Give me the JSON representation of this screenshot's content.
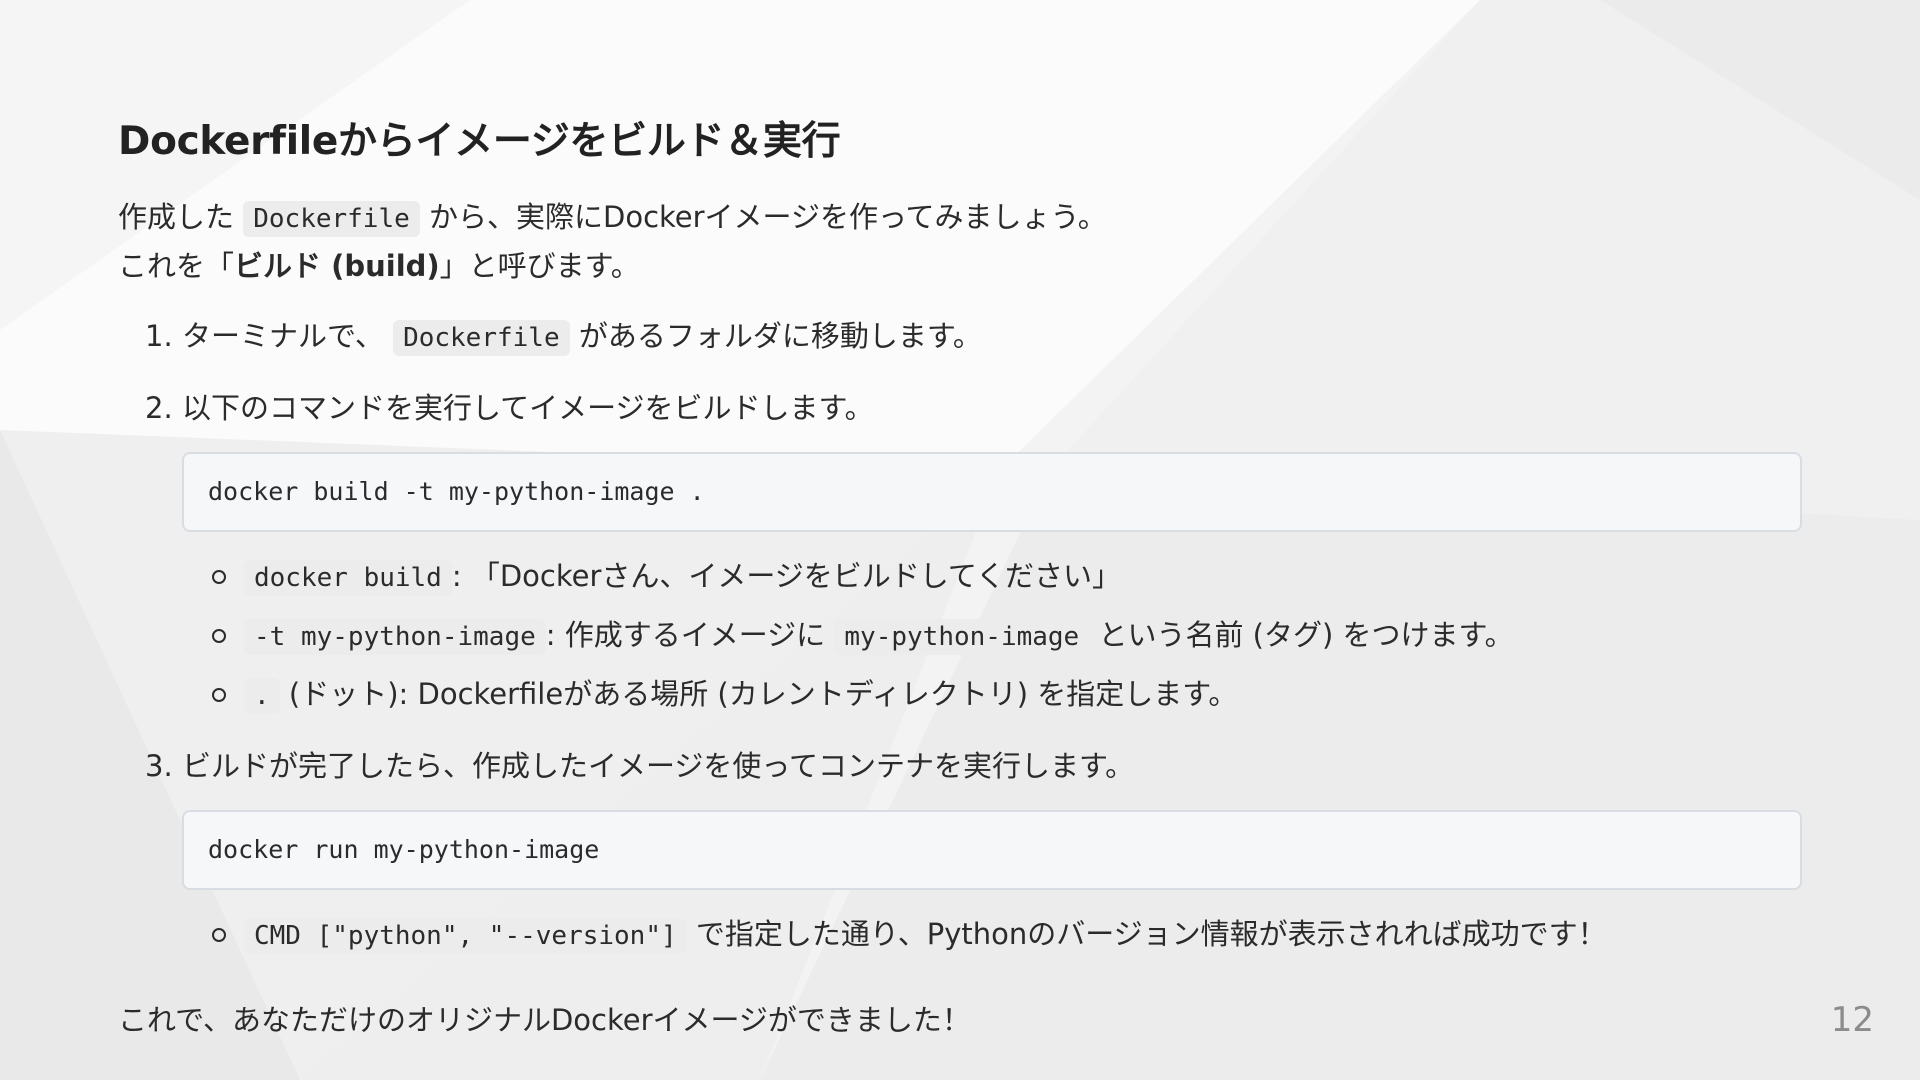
{
  "title": "Dockerfileからイメージをビルド＆実行",
  "intro": {
    "line1_before": "作成した",
    "line1_code": "Dockerfile",
    "line1_after": "から、実際にDockerイメージを作ってみましょう。",
    "line2_before": "これを「",
    "line2_bold": "ビルド (build)",
    "line2_after": "」と呼びます。"
  },
  "steps": [
    {
      "number": "1.",
      "text_before": "ターミナルで、",
      "code": "Dockerfile",
      "text_after": "があるフォルダに移動します。"
    },
    {
      "number": "2.",
      "text": "以下のコマンドを実行してイメージをビルドします。",
      "codeblock": "docker build -t my-python-image .",
      "bullets": [
        {
          "code": "docker build",
          "text": ": 「Dockerさん、イメージをビルドしてください」"
        },
        {
          "code": "-t my-python-image",
          "text": ": 作成するイメージに",
          "code2": "my-python-image",
          "text2": "という名前 (タグ) をつけます。"
        },
        {
          "code": ".",
          "text": "(ドット): Dockerfileがある場所 (カレントディレクトリ) を指定します。"
        }
      ]
    },
    {
      "number": "3.",
      "text": "ビルドが完了したら、作成したイメージを使ってコンテナを実行します。",
      "codeblock": "docker run my-python-image",
      "bullets": [
        {
          "code": "CMD [\"python\", \"--version\"]",
          "text": "で指定した通り、Pythonのバージョン情報が表示されれば成功です！"
        }
      ]
    }
  ],
  "outro": "これで、あなただけのオリジナルDockerイメージができました！",
  "page_number": "12"
}
